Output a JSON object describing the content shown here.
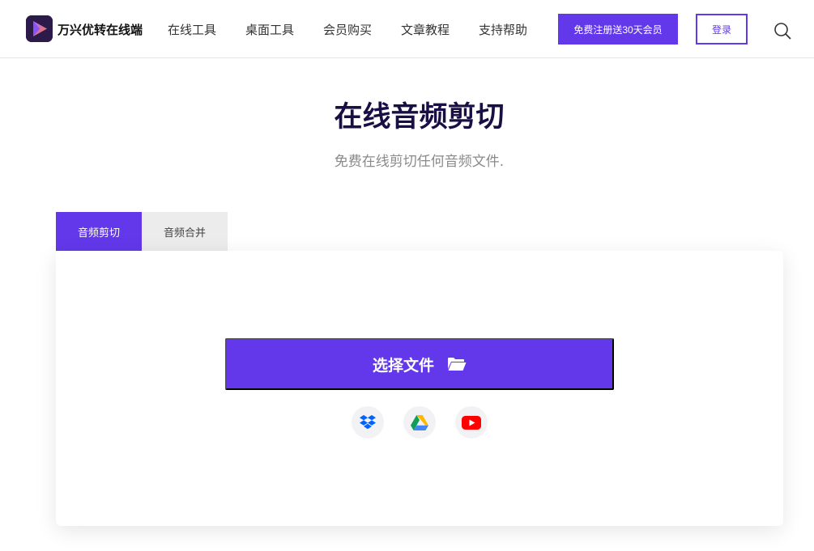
{
  "header": {
    "brand": "万兴优转在线端",
    "nav": [
      "在线工具",
      "桌面工具",
      "会员购买",
      "文章教程",
      "支持帮助"
    ],
    "register_label": "免费注册送30天会员",
    "login_label": "登录"
  },
  "hero": {
    "title": "在线音频剪切",
    "subtitle": "免费在线剪切任何音频文件."
  },
  "tabs": [
    {
      "label": "音频剪切",
      "active": true
    },
    {
      "label": "音频合并",
      "active": false
    }
  ],
  "upload": {
    "select_label": "选择文件",
    "cloud_sources": [
      "dropbox-icon",
      "google-drive-icon",
      "youtube-icon"
    ]
  },
  "colors": {
    "accent": "#6238ea",
    "title": "#190f45",
    "subtitle": "#8a8a8a"
  }
}
